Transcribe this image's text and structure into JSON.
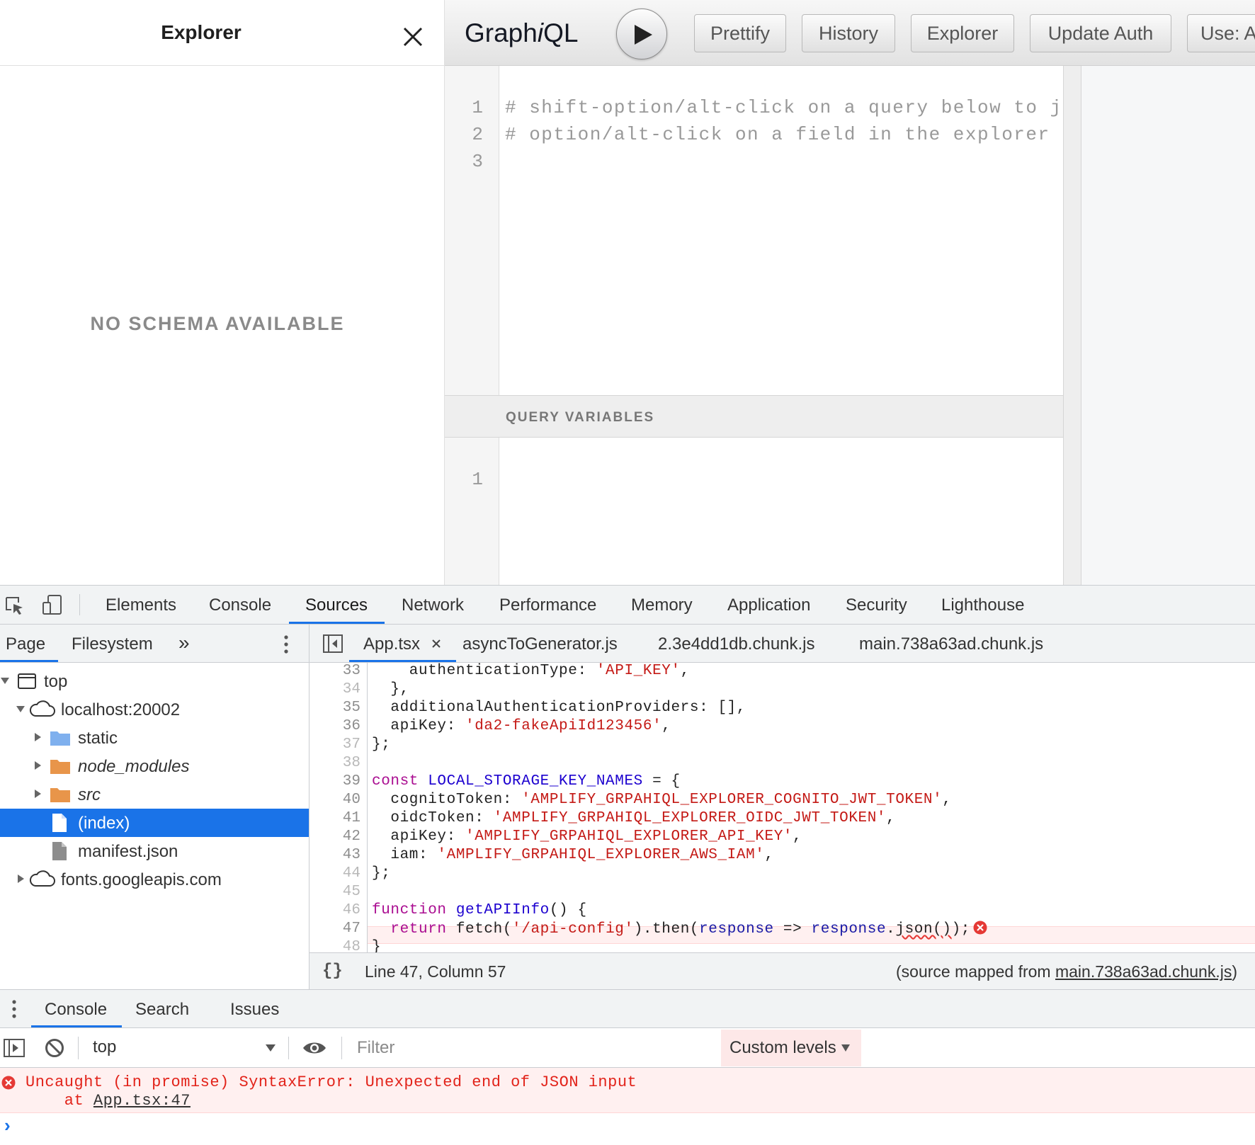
{
  "explorer": {
    "title": "Explorer",
    "empty_message": "NO SCHEMA AVAILABLE"
  },
  "graphiql": {
    "logo_prefix": "Graph",
    "logo_i": "i",
    "logo_suffix": "QL",
    "buttons": [
      "Prettify",
      "History",
      "Explorer",
      "Update Auth",
      "Use: A"
    ],
    "query_lines": [
      {
        "n": "1",
        "text": "# shift-option/alt-click on a query below to jump t"
      },
      {
        "n": "2",
        "text": "# option/alt-click on a field in the explorer to se"
      },
      {
        "n": "3",
        "text": ""
      }
    ],
    "variables_title": "QUERY VARIABLES",
    "variables_lines": [
      {
        "n": "1",
        "text": ""
      }
    ]
  },
  "devtools": {
    "main_tabs": [
      "Elements",
      "Console",
      "Sources",
      "Network",
      "Performance",
      "Memory",
      "Application",
      "Security",
      "Lighthouse"
    ],
    "active_tab": "Sources",
    "navigator": {
      "tabs": [
        "Page",
        "Filesystem"
      ],
      "more": "»",
      "tree": [
        "top",
        "localhost:20002",
        "static",
        "node_modules",
        "src",
        "(index)",
        "manifest.json",
        "fonts.googleapis.com"
      ],
      "selected": "(index)"
    },
    "file_tabs": [
      "App.tsx",
      "asyncToGenerator.js",
      "2.3e4dd1db.chunk.js",
      "main.738a63ad.chunk.js"
    ],
    "active_file": "App.tsx",
    "code": {
      "line_numbers": [
        "33",
        "34",
        "35",
        "36",
        "37",
        "38",
        "39",
        "40",
        "41",
        "42",
        "43",
        "44",
        "45",
        "46",
        "47",
        "48"
      ],
      "l33_a": "    authenticationType: ",
      "l33_b": "'API_KEY'",
      "l33_c": ",",
      "l34": "  },",
      "l35": "  additionalAuthenticationProviders: [],",
      "l36_a": "  apiKey: ",
      "l36_b": "'da2-fakeApiId123456'",
      "l36_c": ",",
      "l37": "};",
      "l39_kw": "const",
      "l39_def": " LOCAL_STORAGE_KEY_NAMES",
      "l39_rest": " = {",
      "l40_a": "  cognitoToken: ",
      "l40_b": "'AMPLIFY_GRPAHIQL_EXPLORER_COGNITO_JWT_TOKEN'",
      "l40_c": ",",
      "l41_a": "  oidcToken: ",
      "l41_b": "'AMPLIFY_GRPAHIQL_EXPLORER_OIDC_JWT_TOKEN'",
      "l41_c": ",",
      "l42_a": "  apiKey: ",
      "l42_b": "'AMPLIFY_GRPAHIQL_EXPLORER_API_KEY'",
      "l42_c": ",",
      "l43_a": "  iam: ",
      "l43_b": "'AMPLIFY_GRPAHIQL_EXPLORER_AWS_IAM'",
      "l43_c": ",",
      "l44": "};",
      "l46_kw": "function",
      "l46_def": " getAPIInfo",
      "l46_rest": "() {",
      "l47_kw": "  return",
      "l47_a": " fetch(",
      "l47_str": "'/api-config'",
      "l47_b": ").then(",
      "l47_var1": "response",
      "l47_arrow": " => ",
      "l47_var2": "response",
      "l47_dot": ".",
      "l47_json": "json()",
      "l47_end": ");",
      "l48": "}"
    },
    "status": {
      "format_glyph": "{}",
      "position": "Line 47, Column 57",
      "source_map_prefix": "(source mapped from ",
      "source_map_file": "main.738a63ad.chunk.js",
      "source_map_suffix": ")"
    },
    "drawer": {
      "tabs": [
        "Console",
        "Search",
        "Issues"
      ],
      "context": "top",
      "filter_placeholder": "Filter",
      "levels": "Custom levels",
      "error_message": "Uncaught (in promise) SyntaxError: Unexpected end of JSON input",
      "error_at": "    at ",
      "error_link": "App.tsx:47",
      "prompt": "›"
    }
  },
  "colors": {
    "accent": "#1a73e8",
    "error": "#e2231a",
    "string": "#c41a16",
    "keyword": "#aa0d91"
  }
}
